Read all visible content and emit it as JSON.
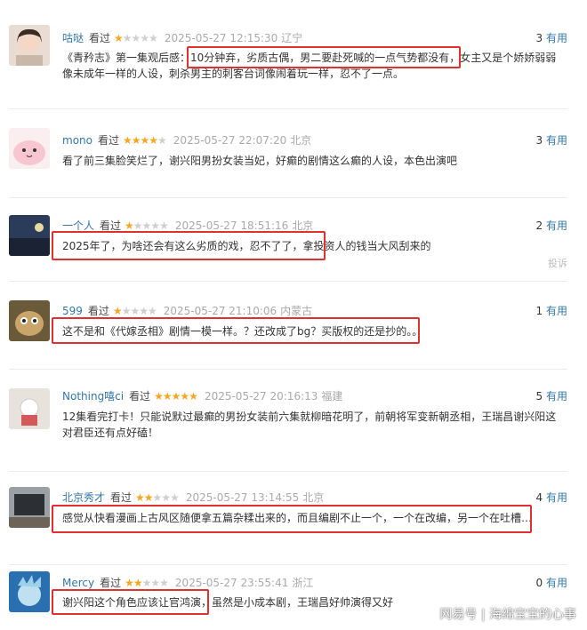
{
  "comments": [
    {
      "user": "咕哒",
      "status": "看过",
      "stars": 1,
      "time": "2025-05-27 12:15:30",
      "location": "辽宁",
      "useful_count": "3",
      "useful_label": "有用",
      "text": "《青矜志》第一集观后感：10分钟弃，劣质古偶，男二要赴死喊的一点气势都没有，女主又是个娇娇弱弱像未成年一样的人设，刺杀男主的刺客台词像闹着玩一样，忍不了一点。"
    },
    {
      "user": "mono",
      "status": "看过",
      "stars": 4,
      "time": "2025-05-27 22:07:20",
      "location": "北京",
      "useful_count": "3",
      "useful_label": "有用",
      "text": "看了前三集脸笑烂了，谢兴阳男扮女装当妃，好癫的剧情这么癫的人设，本色出演吧"
    },
    {
      "user": "一个人",
      "status": "看过",
      "stars": 1,
      "time": "2025-05-27 18:51:16",
      "location": "北京",
      "useful_count": "2",
      "useful_label": "有用",
      "text": "2025年了，为啥还会有这么劣质的戏，忍不了了，拿投资人的钱当大风刮来的",
      "report": "投诉"
    },
    {
      "user": "599",
      "status": "看过",
      "stars": 1,
      "time": "2025-05-27 21:10:06",
      "location": "内蒙古",
      "useful_count": "1",
      "useful_label": "有用",
      "text": "这不是和《代嫁丞相》剧情一模一样。？还改成了bg？买版权的还是抄的。。"
    },
    {
      "user": "Nothing嘻ci",
      "status": "看过",
      "stars": 5,
      "time": "2025-05-27 20:16:13",
      "location": "福建",
      "useful_count": "5",
      "useful_label": "有用",
      "text": "12集看完打卡！只能说默过最癫的男扮女装前六集就柳暗花明了，前朝将军变新朝丞相，王瑞昌谢兴阳这对君臣还有点好磕！"
    },
    {
      "user": "北京秀才",
      "status": "看过",
      "stars": 2,
      "time": "2025-05-27 13:14:55",
      "location": "北京",
      "useful_count": "4",
      "useful_label": "有用",
      "text": "感觉从快看漫画上古风区随便拿五篇杂糅出来的，而且编剧不止一个，一个在改编，另一个在吐槽…"
    },
    {
      "user": "Mercy",
      "status": "看过",
      "stars": 2,
      "time": "2025-05-27 23:55:41",
      "location": "浙江",
      "useful_count": "0",
      "useful_label": "有用",
      "text": "谢兴阳这个角色应该让官鸿演，虽然是小成本剧，王瑞昌好帅演得又好"
    }
  ],
  "watermark": "网易号 | 海绵宝宝的心事",
  "colors": {
    "highlight": "#e03030",
    "username": "#3377aa",
    "star": "#f5a623"
  },
  "avatar_icons": [
    "girl-avatar-icon",
    "pink-blob-avatar-icon",
    "landscape-avatar-icon",
    "cartoon-animal-avatar-icon",
    "plush-toy-avatar-icon",
    "room-photo-avatar-icon",
    "rick-cartoon-avatar-icon"
  ]
}
